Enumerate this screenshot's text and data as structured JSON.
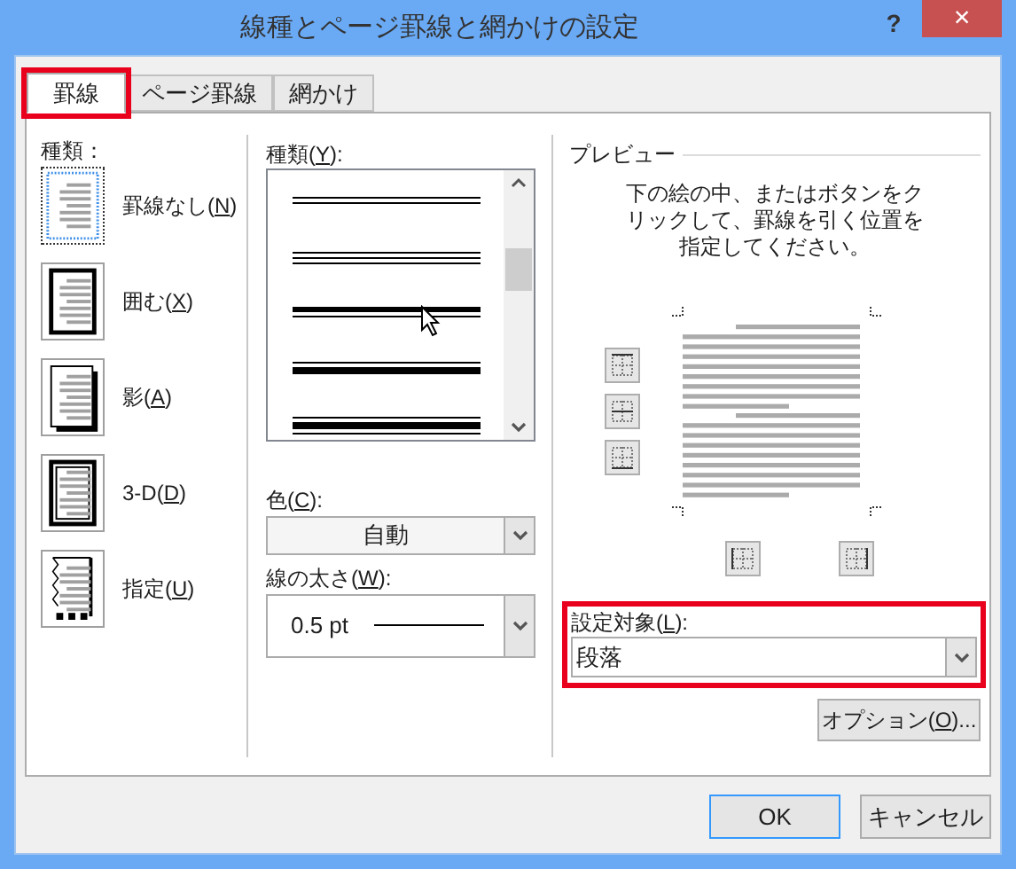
{
  "window": {
    "title": "線種とページ罫線と網かけの設定",
    "help": "?",
    "close": "×"
  },
  "tabs": [
    {
      "label": "罫線",
      "selected": true,
      "highlighted": true
    },
    {
      "label": "ページ罫線",
      "selected": false,
      "highlighted": false
    },
    {
      "label": "網かけ",
      "selected": false,
      "highlighted": false
    }
  ],
  "setting": {
    "label": "種類：",
    "items": [
      {
        "kind": "none",
        "selected": true,
        "label": {
          "pre": "罫線なし(",
          "key": "N",
          "post": ")"
        }
      },
      {
        "kind": "box",
        "selected": false,
        "label": {
          "pre": "囲む(",
          "key": "X",
          "post": ")"
        }
      },
      {
        "kind": "shadow",
        "selected": false,
        "label": {
          "pre": "影(",
          "key": "A",
          "post": ")"
        }
      },
      {
        "kind": "threed",
        "selected": false,
        "label": {
          "pre": "3-D(",
          "key": "D",
          "post": ")"
        }
      },
      {
        "kind": "custom",
        "selected": false,
        "label": {
          "pre": "指定(",
          "key": "U",
          "post": ")"
        }
      }
    ]
  },
  "style": {
    "label": {
      "pre": "種類(",
      "key": "Y",
      "post": "):"
    },
    "lines": [
      {
        "kind": "double"
      },
      {
        "kind": "triple"
      },
      {
        "kind": "thick-thin"
      },
      {
        "kind": "thin-thick"
      },
      {
        "kind": "thin-thick-thin"
      }
    ]
  },
  "color": {
    "label": {
      "pre": "色(",
      "key": "C",
      "post": "):"
    },
    "value": "自動"
  },
  "width": {
    "label": {
      "pre": "線の太さ(",
      "key": "W",
      "post": "):"
    },
    "value": "0.5 pt"
  },
  "preview": {
    "legend": "プレビュー",
    "instructions": "下の絵の中、またはボタンをクリックして、罫線を引く位置を指定してください。"
  },
  "apply_to": {
    "highlighted": true,
    "label": {
      "pre": "設定対象(",
      "key": "L",
      "post": "):"
    },
    "value": "段落"
  },
  "options_button": {
    "pre": "オプション(",
    "key": "O",
    "post": ")..."
  },
  "buttons": [
    {
      "label": "OK",
      "default": true
    },
    {
      "label": "キャンセル",
      "default": false
    }
  ]
}
